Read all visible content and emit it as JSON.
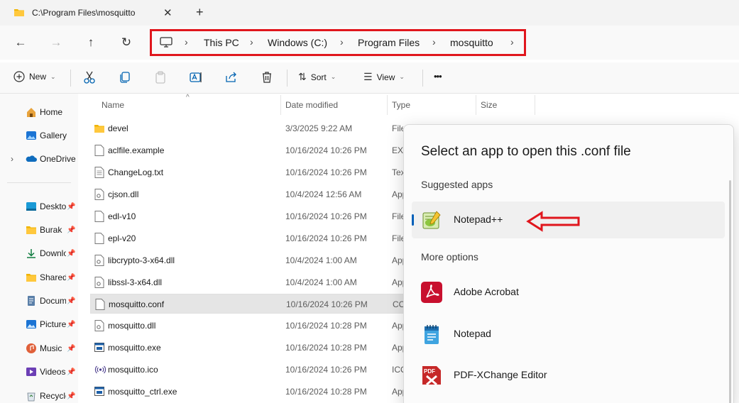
{
  "tab": {
    "title": "C:\\Program Files\\mosquitto",
    "close": "✕",
    "new_tab": "+"
  },
  "nav": {
    "back": "←",
    "forward": "→",
    "up": "↑",
    "refresh": "↻",
    "breadcrumbs": [
      "This PC",
      "Windows (C:)",
      "Program Files",
      "mosquitto"
    ],
    "separator": "›"
  },
  "commands": {
    "new_label": "New",
    "sort_label": "Sort",
    "view_label": "View",
    "more": "•••",
    "caret": "⌄"
  },
  "sidebar": {
    "items": [
      {
        "label": "Home",
        "icon": "home-icon",
        "pinned": false
      },
      {
        "label": "Gallery",
        "icon": "gallery-icon",
        "pinned": false
      },
      {
        "label": "OneDrive",
        "icon": "cloud-icon",
        "pinned": false,
        "expand": "›"
      },
      {
        "label": "Desktop",
        "icon": "desktop-icon",
        "pinned": true
      },
      {
        "label": "Burak",
        "icon": "folder-icon",
        "pinned": true
      },
      {
        "label": "Downloads",
        "icon": "download-icon",
        "pinned": true
      },
      {
        "label": "Shared",
        "icon": "folder-icon",
        "pinned": true
      },
      {
        "label": "Documents",
        "icon": "document-icon",
        "pinned": true
      },
      {
        "label": "Pictures",
        "icon": "pictures-icon",
        "pinned": true
      },
      {
        "label": "Music",
        "icon": "music-icon",
        "pinned": true
      },
      {
        "label": "Videos",
        "icon": "videos-icon",
        "pinned": true
      },
      {
        "label": "Recycle Bin",
        "icon": "recycle-bin-icon",
        "pinned": true
      }
    ],
    "pin_glyph": "📌"
  },
  "columns": {
    "name": "Name",
    "date": "Date modified",
    "type": "Type",
    "size": "Size",
    "sort_caret": "^"
  },
  "files": [
    {
      "name": "devel",
      "date": "3/3/2025 9:22 AM",
      "type": "File folder",
      "icon": "folder-icon"
    },
    {
      "name": "aclfile.example",
      "date": "10/16/2024 10:26 PM",
      "type": "EXAMPLE File",
      "icon": "file-icon"
    },
    {
      "name": "ChangeLog.txt",
      "date": "10/16/2024 10:26 PM",
      "type": "Text Document",
      "icon": "text-file-icon"
    },
    {
      "name": "cjson.dll",
      "date": "10/4/2024 12:56 AM",
      "type": "Application extension",
      "icon": "dll-icon"
    },
    {
      "name": "edl-v10",
      "date": "10/16/2024 10:26 PM",
      "type": "File",
      "icon": "file-icon"
    },
    {
      "name": "epl-v20",
      "date": "10/16/2024 10:26 PM",
      "type": "File",
      "icon": "file-icon"
    },
    {
      "name": "libcrypto-3-x64.dll",
      "date": "10/4/2024 1:00 AM",
      "type": "Application extension",
      "icon": "dll-icon"
    },
    {
      "name": "libssl-3-x64.dll",
      "date": "10/4/2024 1:00 AM",
      "type": "Application extension",
      "icon": "dll-icon"
    },
    {
      "name": "mosquitto.conf",
      "date": "10/16/2024 10:26 PM",
      "type": "CONF File",
      "icon": "file-icon",
      "selected": true
    },
    {
      "name": "mosquitto.dll",
      "date": "10/16/2024 10:28 PM",
      "type": "Application extension",
      "icon": "dll-icon"
    },
    {
      "name": "mosquitto.exe",
      "date": "10/16/2024 10:28 PM",
      "type": "Application",
      "icon": "exe-icon"
    },
    {
      "name": "mosquitto.ico",
      "date": "10/16/2024 10:26 PM",
      "type": "ICO File",
      "icon": "ico-file-icon"
    },
    {
      "name": "mosquitto_ctrl.exe",
      "date": "10/16/2024 10:28 PM",
      "type": "Application",
      "icon": "exe-icon"
    }
  ],
  "dialog": {
    "title": "Select an app to open this .conf file",
    "suggested_heading": "Suggested apps",
    "more_heading": "More options",
    "suggested": [
      {
        "label": "Notepad++",
        "icon": "notepad-plus-plus-icon"
      }
    ],
    "more": [
      {
        "label": "Adobe Acrobat",
        "icon": "adobe-acrobat-icon"
      },
      {
        "label": "Notepad",
        "icon": "notepad-icon"
      },
      {
        "label": "PDF-XChange Editor",
        "icon": "pdf-xchange-icon"
      }
    ]
  },
  "colors": {
    "annotation_red": "#e0161d",
    "accent": "#005fb8",
    "selection": "#e5e5e5"
  }
}
